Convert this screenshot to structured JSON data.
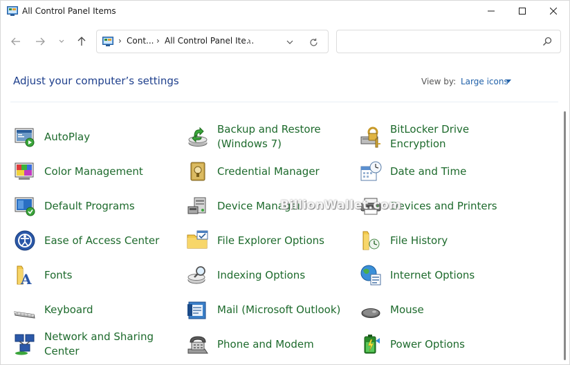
{
  "window": {
    "title": "All Control Panel Items"
  },
  "address": {
    "crumbs": [
      "Cont...",
      "All Control Panel Ite..."
    ]
  },
  "search": {
    "placeholder": ""
  },
  "heading": "Adjust your computer’s settings",
  "view_by": {
    "label": "View by:",
    "value": "Large icons"
  },
  "watermark": "BillionWallet.com",
  "colors": {
    "heading": "#1e3f8c",
    "link": "#1d6a2c",
    "accent": "#1e5fa8"
  },
  "items": [
    {
      "label": "AutoPlay",
      "icon": "autoplay-icon"
    },
    {
      "label": "Backup and Restore (Windows 7)",
      "icon": "backup-restore-icon"
    },
    {
      "label": "BitLocker Drive Encryption",
      "icon": "bitlocker-icon"
    },
    {
      "label": "Color Management",
      "icon": "color-management-icon"
    },
    {
      "label": "Credential Manager",
      "icon": "credential-manager-icon"
    },
    {
      "label": "Date and Time",
      "icon": "date-time-icon"
    },
    {
      "label": "Default Programs",
      "icon": "default-programs-icon"
    },
    {
      "label": "Device Manager",
      "icon": "device-manager-icon"
    },
    {
      "label": "Devices and Printers",
      "icon": "devices-printers-icon"
    },
    {
      "label": "Ease of Access Center",
      "icon": "ease-of-access-icon"
    },
    {
      "label": "File Explorer Options",
      "icon": "file-explorer-options-icon"
    },
    {
      "label": "File History",
      "icon": "file-history-icon"
    },
    {
      "label": "Fonts",
      "icon": "fonts-icon"
    },
    {
      "label": "Indexing Options",
      "icon": "indexing-options-icon"
    },
    {
      "label": "Internet Options",
      "icon": "internet-options-icon"
    },
    {
      "label": "Keyboard",
      "icon": "keyboard-icon"
    },
    {
      "label": "Mail (Microsoft Outlook)",
      "icon": "mail-icon"
    },
    {
      "label": "Mouse",
      "icon": "mouse-icon"
    },
    {
      "label": "Network and Sharing Center",
      "icon": "network-sharing-icon"
    },
    {
      "label": "Phone and Modem",
      "icon": "phone-modem-icon"
    },
    {
      "label": "Power Options",
      "icon": "power-options-icon"
    }
  ]
}
